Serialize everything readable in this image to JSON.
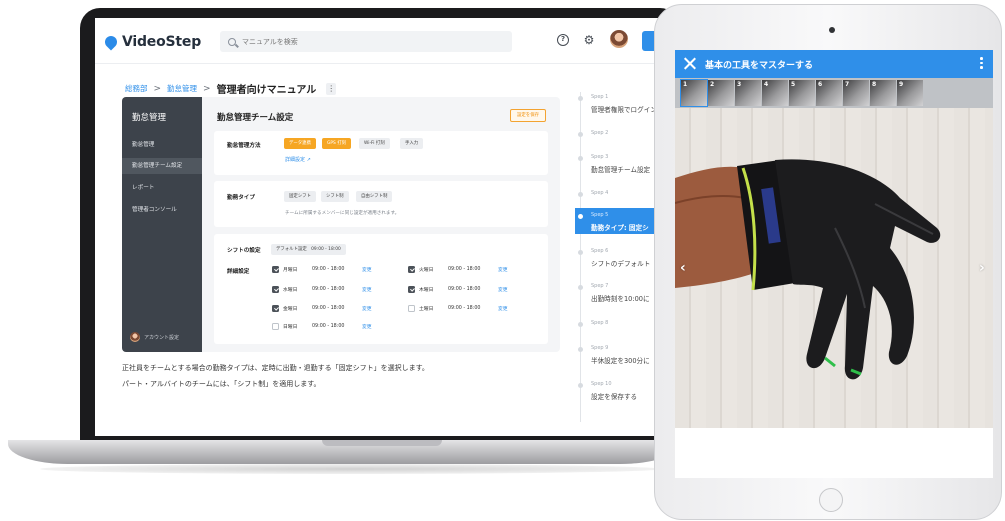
{
  "laptop": {
    "app": {
      "logo_text": "VideoStep",
      "search_placeholder": "マニュアルを検索",
      "plus_label": "+",
      "help_icon_glyph": "?",
      "gear_icon_glyph": "⚙"
    },
    "breadcrumb": {
      "items": [
        "総務部",
        "勤怠管理"
      ],
      "separator": ">",
      "current": "管理者向けマニュアル",
      "more": "⋮"
    },
    "sidebar": {
      "title": "勤怠管理",
      "items": [
        {
          "label": "勤怠管理"
        },
        {
          "label": "勤怠管理チーム設定"
        },
        {
          "label": "レポート"
        },
        {
          "label": "管理者コンソール"
        }
      ],
      "account_label": "アカウント設定"
    },
    "panel": {
      "title": "勤怠管理チーム設定",
      "save_label": "設定を保存",
      "method": {
        "label": "勤怠管理方法",
        "options": [
          "データ連携",
          "GPS 打刻",
          "Wi-Fi 打刻",
          "手入力"
        ],
        "detail_link": "詳細設定 ↗"
      },
      "work_type": {
        "label": "勤務タイプ",
        "options": [
          "固定シフト",
          "シフト制",
          "自由シフト制"
        ],
        "note": "チームに所属するメンバーに同じ設定が適用されます。"
      },
      "shift": {
        "label": "シフトの設定",
        "default_label": "デフォルト設定　09:00 - 18:00",
        "detail_label": "詳細設定",
        "change_label": "変更",
        "days": [
          {
            "day": "月曜日",
            "time": "09:00 - 18:00",
            "checked": true
          },
          {
            "day": "水曜日",
            "time": "09:00 - 18:00",
            "checked": true
          },
          {
            "day": "金曜日",
            "time": "09:00 - 18:00",
            "checked": true
          },
          {
            "day": "日曜日",
            "time": "09:00 - 18:00",
            "checked": false
          },
          {
            "day": "火曜日",
            "time": "09:00 - 18:00",
            "checked": true
          },
          {
            "day": "木曜日",
            "time": "09:00 - 18:00",
            "checked": true
          },
          {
            "day": "土曜日",
            "time": "09:00 - 18:00",
            "checked": false
          }
        ]
      }
    },
    "description": [
      "正社員をチームとする場合の勤務タイプは、定時に出勤・退勤する「固定シフト」を選択します。",
      "パート・アルバイトのチームには、「シフト制」を適用します。"
    ],
    "steps": [
      {
        "num": "Spep 1",
        "text": "管理者権限でログイン"
      },
      {
        "num": "Spep 2",
        "text": ""
      },
      {
        "num": "Spep 3",
        "text": "勤怠管理チーム設定"
      },
      {
        "num": "Spep 4",
        "text": ""
      },
      {
        "num": "Spep 5",
        "text": "勤務タイプ: 固定シ",
        "active": true
      },
      {
        "num": "Spep 6",
        "text": "シフトのデフォルト"
      },
      {
        "num": "Spep 7",
        "text": "出勤時刻を10:00に"
      },
      {
        "num": "Spep 8",
        "text": ""
      },
      {
        "num": "Spep 9",
        "text": "半休設定を300分に"
      },
      {
        "num": "Spep 10",
        "text": "設定を保存する"
      }
    ]
  },
  "tablet": {
    "title": "基本の工具をマスターする",
    "close_icon": "close-icon",
    "menu_icon": "kebab-icon",
    "thumbnails": [
      "1",
      "2",
      "3",
      "4",
      "5",
      "6",
      "7",
      "8",
      "9"
    ],
    "active_thumbnail": "1",
    "prev_arrow": "‹",
    "next_arrow": "›",
    "photo_subject": "work-glove-on-hand"
  },
  "colors": {
    "brand_blue": "#2f8fe9",
    "accent_orange": "#f6a623",
    "sidebar_dark": "#3d434b"
  }
}
